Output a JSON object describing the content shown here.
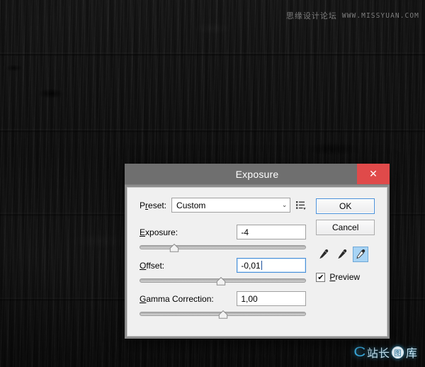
{
  "background": {
    "description": "dark wood plank texture",
    "color": "#141414"
  },
  "watermarks": {
    "top": {
      "chinese": "思缘设计论坛",
      "url": "WWW.MISSYUAN.COM"
    },
    "logo": {
      "swoosh": "C",
      "text_left": "站长",
      "badge": "图",
      "text_right": "库"
    }
  },
  "dialog": {
    "title": "Exposure",
    "close_label": "✕",
    "accent_blue": "#4a90d9",
    "close_red": "#e04a4a",
    "titlebar_gray": "#6f6f6f",
    "body_gray": "#f0f0f0",
    "preset": {
      "label_pre": "P",
      "label_accel": "r",
      "label_post": "eset:",
      "value": "Custom",
      "caret": "⌄",
      "menu_icon": "preset-list-icon"
    },
    "fields": [
      {
        "id": "exposure",
        "label_pre": "",
        "label_accel": "E",
        "label_post": "xposure:",
        "value": "-4",
        "focused": false,
        "slider_percent": 21
      },
      {
        "id": "offset",
        "label_pre": "",
        "label_accel": "O",
        "label_post": "ffset:",
        "value": "-0,01",
        "focused": true,
        "slider_percent": 49
      },
      {
        "id": "gamma",
        "label_pre": "",
        "label_accel": "G",
        "label_post": "amma Correction:",
        "value": "1,00",
        "focused": false,
        "slider_percent": 50
      }
    ],
    "buttons": {
      "ok": "OK",
      "cancel": "Cancel"
    },
    "eyedroppers": [
      {
        "name": "set-black-point-eyedropper",
        "active": false
      },
      {
        "name": "set-gray-point-eyedropper",
        "active": false
      },
      {
        "name": "set-white-point-eyedropper",
        "active": true
      }
    ],
    "preview": {
      "checked": true,
      "check_glyph": "✔",
      "label_pre": "",
      "label_accel": "P",
      "label_post": "review"
    }
  }
}
